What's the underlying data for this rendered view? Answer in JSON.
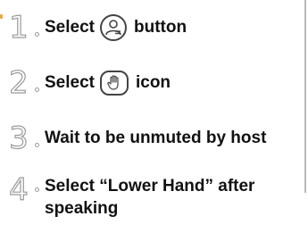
{
  "steps": [
    {
      "number": "1",
      "text_before": "Select",
      "icon": "participants-icon",
      "text_after": "button"
    },
    {
      "number": "2",
      "text_before": "Select",
      "icon": "raise-hand-icon",
      "text_after": "icon"
    },
    {
      "number": "3",
      "text": "Wait to be unmuted by host"
    },
    {
      "number": "4",
      "text_line1": "Select “Lower Hand” after",
      "text_line2": "speaking"
    }
  ]
}
